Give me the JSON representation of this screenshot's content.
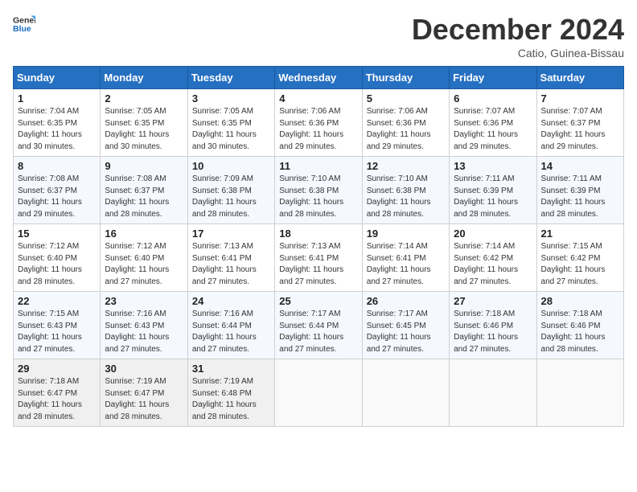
{
  "logo": {
    "text_general": "General",
    "text_blue": "Blue"
  },
  "title": "December 2024",
  "location": "Catio, Guinea-Bissau",
  "weekdays": [
    "Sunday",
    "Monday",
    "Tuesday",
    "Wednesday",
    "Thursday",
    "Friday",
    "Saturday"
  ],
  "weeks": [
    [
      {
        "day": "1",
        "detail": "Sunrise: 7:04 AM\nSunset: 6:35 PM\nDaylight: 11 hours\nand 30 minutes."
      },
      {
        "day": "2",
        "detail": "Sunrise: 7:05 AM\nSunset: 6:35 PM\nDaylight: 11 hours\nand 30 minutes."
      },
      {
        "day": "3",
        "detail": "Sunrise: 7:05 AM\nSunset: 6:35 PM\nDaylight: 11 hours\nand 30 minutes."
      },
      {
        "day": "4",
        "detail": "Sunrise: 7:06 AM\nSunset: 6:36 PM\nDaylight: 11 hours\nand 29 minutes."
      },
      {
        "day": "5",
        "detail": "Sunrise: 7:06 AM\nSunset: 6:36 PM\nDaylight: 11 hours\nand 29 minutes."
      },
      {
        "day": "6",
        "detail": "Sunrise: 7:07 AM\nSunset: 6:36 PM\nDaylight: 11 hours\nand 29 minutes."
      },
      {
        "day": "7",
        "detail": "Sunrise: 7:07 AM\nSunset: 6:37 PM\nDaylight: 11 hours\nand 29 minutes."
      }
    ],
    [
      {
        "day": "8",
        "detail": "Sunrise: 7:08 AM\nSunset: 6:37 PM\nDaylight: 11 hours\nand 29 minutes."
      },
      {
        "day": "9",
        "detail": "Sunrise: 7:08 AM\nSunset: 6:37 PM\nDaylight: 11 hours\nand 28 minutes."
      },
      {
        "day": "10",
        "detail": "Sunrise: 7:09 AM\nSunset: 6:38 PM\nDaylight: 11 hours\nand 28 minutes."
      },
      {
        "day": "11",
        "detail": "Sunrise: 7:10 AM\nSunset: 6:38 PM\nDaylight: 11 hours\nand 28 minutes."
      },
      {
        "day": "12",
        "detail": "Sunrise: 7:10 AM\nSunset: 6:38 PM\nDaylight: 11 hours\nand 28 minutes."
      },
      {
        "day": "13",
        "detail": "Sunrise: 7:11 AM\nSunset: 6:39 PM\nDaylight: 11 hours\nand 28 minutes."
      },
      {
        "day": "14",
        "detail": "Sunrise: 7:11 AM\nSunset: 6:39 PM\nDaylight: 11 hours\nand 28 minutes."
      }
    ],
    [
      {
        "day": "15",
        "detail": "Sunrise: 7:12 AM\nSunset: 6:40 PM\nDaylight: 11 hours\nand 28 minutes."
      },
      {
        "day": "16",
        "detail": "Sunrise: 7:12 AM\nSunset: 6:40 PM\nDaylight: 11 hours\nand 27 minutes."
      },
      {
        "day": "17",
        "detail": "Sunrise: 7:13 AM\nSunset: 6:41 PM\nDaylight: 11 hours\nand 27 minutes."
      },
      {
        "day": "18",
        "detail": "Sunrise: 7:13 AM\nSunset: 6:41 PM\nDaylight: 11 hours\nand 27 minutes."
      },
      {
        "day": "19",
        "detail": "Sunrise: 7:14 AM\nSunset: 6:41 PM\nDaylight: 11 hours\nand 27 minutes."
      },
      {
        "day": "20",
        "detail": "Sunrise: 7:14 AM\nSunset: 6:42 PM\nDaylight: 11 hours\nand 27 minutes."
      },
      {
        "day": "21",
        "detail": "Sunrise: 7:15 AM\nSunset: 6:42 PM\nDaylight: 11 hours\nand 27 minutes."
      }
    ],
    [
      {
        "day": "22",
        "detail": "Sunrise: 7:15 AM\nSunset: 6:43 PM\nDaylight: 11 hours\nand 27 minutes."
      },
      {
        "day": "23",
        "detail": "Sunrise: 7:16 AM\nSunset: 6:43 PM\nDaylight: 11 hours\nand 27 minutes."
      },
      {
        "day": "24",
        "detail": "Sunrise: 7:16 AM\nSunset: 6:44 PM\nDaylight: 11 hours\nand 27 minutes."
      },
      {
        "day": "25",
        "detail": "Sunrise: 7:17 AM\nSunset: 6:44 PM\nDaylight: 11 hours\nand 27 minutes."
      },
      {
        "day": "26",
        "detail": "Sunrise: 7:17 AM\nSunset: 6:45 PM\nDaylight: 11 hours\nand 27 minutes."
      },
      {
        "day": "27",
        "detail": "Sunrise: 7:18 AM\nSunset: 6:46 PM\nDaylight: 11 hours\nand 27 minutes."
      },
      {
        "day": "28",
        "detail": "Sunrise: 7:18 AM\nSunset: 6:46 PM\nDaylight: 11 hours\nand 28 minutes."
      }
    ],
    [
      {
        "day": "29",
        "detail": "Sunrise: 7:18 AM\nSunset: 6:47 PM\nDaylight: 11 hours\nand 28 minutes."
      },
      {
        "day": "30",
        "detail": "Sunrise: 7:19 AM\nSunset: 6:47 PM\nDaylight: 11 hours\nand 28 minutes."
      },
      {
        "day": "31",
        "detail": "Sunrise: 7:19 AM\nSunset: 6:48 PM\nDaylight: 11 hours\nand 28 minutes."
      },
      {
        "day": "",
        "detail": ""
      },
      {
        "day": "",
        "detail": ""
      },
      {
        "day": "",
        "detail": ""
      },
      {
        "day": "",
        "detail": ""
      }
    ]
  ]
}
